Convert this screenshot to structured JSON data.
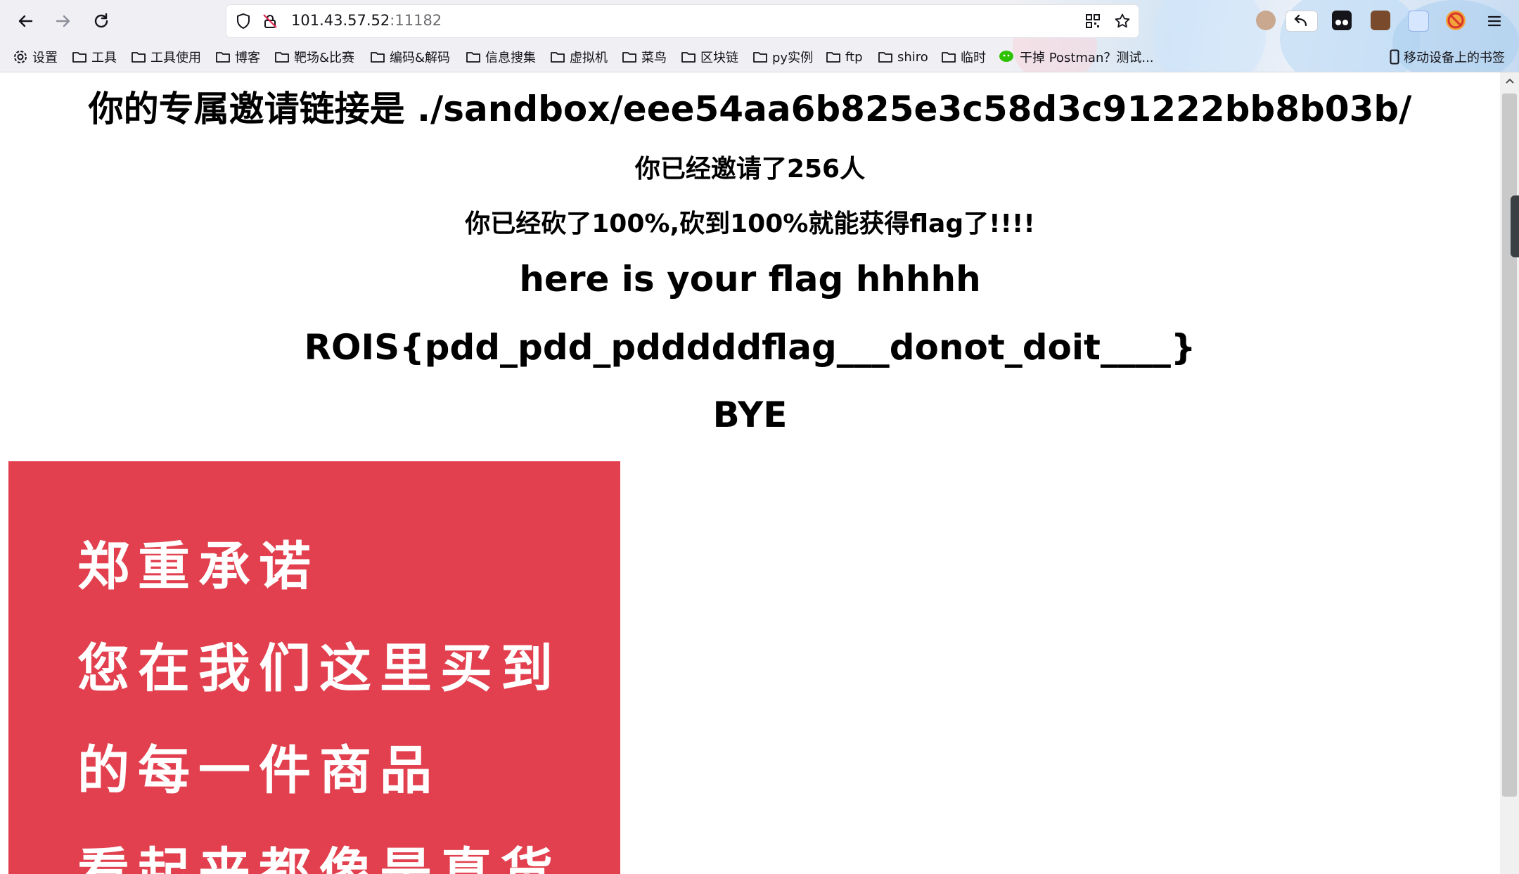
{
  "browser": {
    "url_host": "101.43.57.52",
    "url_port": ":11182",
    "bookmarks": [
      {
        "label": "设置",
        "icon": "gear-icon"
      },
      {
        "label": "工具",
        "icon": "folder-icon"
      },
      {
        "label": "工具使用",
        "icon": "folder-icon"
      },
      {
        "label": "博客",
        "icon": "folder-icon"
      },
      {
        "label": "靶场&比赛",
        "icon": "folder-icon"
      },
      {
        "label": "编码&解码",
        "icon": "folder-icon"
      },
      {
        "label": "信息搜集",
        "icon": "folder-icon"
      },
      {
        "label": "虚拟机",
        "icon": "folder-icon"
      },
      {
        "label": "菜鸟",
        "icon": "folder-icon"
      },
      {
        "label": "区块链",
        "icon": "folder-icon"
      },
      {
        "label": "py实例",
        "icon": "folder-icon"
      },
      {
        "label": "ftp",
        "icon": "folder-icon"
      },
      {
        "label": "shiro",
        "icon": "folder-icon"
      },
      {
        "label": "临时",
        "icon": "folder-icon"
      },
      {
        "label": "干掉 Postman？测试...",
        "icon": "wechat-icon"
      }
    ],
    "mobile_bookmarks": "移动设备上的书签"
  },
  "page": {
    "invite_link": "你的专属邀请链接是 ./sandbox/eee54aa6b825e3c58d3c91222bb8b03b/",
    "invited_count": "你已经邀请了256人",
    "progress_text": "你已经砍了100%,砍到100%就能获得flag了!!!!",
    "flag_intro": "here is your flag hhhhh",
    "flag": "ROIS{pdd_pdd_pdddddflag___donot_doit____}",
    "bye": "BYE"
  },
  "promo": {
    "lines": [
      "郑重承诺",
      "您在我们这里买到",
      "的每一件商品",
      "看起来都像是真货"
    ],
    "background": "#e2404e"
  }
}
